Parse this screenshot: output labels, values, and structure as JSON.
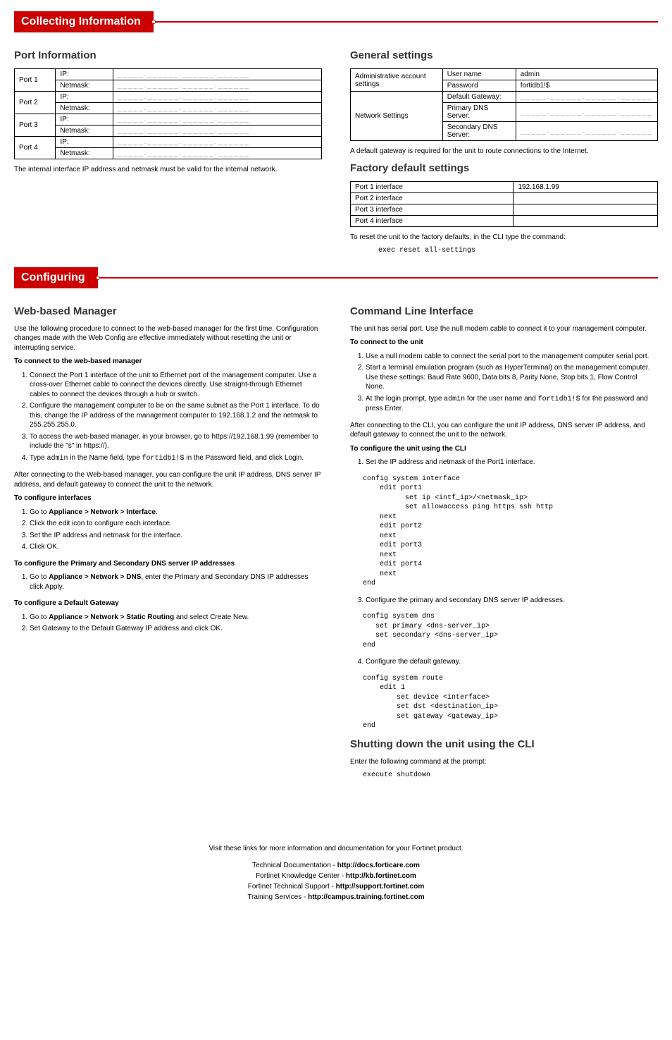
{
  "sections": {
    "collecting": "Collecting Information",
    "configuring": "Configuring"
  },
  "port_info": {
    "title": "Port Information",
    "rows": [
      {
        "label": "Port 1",
        "ip_label": "IP:",
        "mask_label": "Netmask:",
        "blank": "_____.______.______.______"
      },
      {
        "label": "Port 2",
        "ip_label": "IP:",
        "mask_label": "Netmask:",
        "blank": "_____.______.______.______"
      },
      {
        "label": "Port 3",
        "ip_label": "IP:",
        "mask_label": "Netmask:",
        "blank": "_____.______.______.______"
      },
      {
        "label": "Port 4",
        "ip_label": "IP:",
        "mask_label": "Netmask:",
        "blank": "_____.______.______.______"
      }
    ],
    "note": "The internal interface IP address and netmask must be valid for the internal network."
  },
  "general": {
    "title": "General settings",
    "admin_label": "Administrative account settings",
    "user_label": "User name",
    "user_val": "admin",
    "pass_label": "Password",
    "pass_val": "fortidb1!$",
    "net_label": "Network Settings",
    "gw_label": "Default Gateway:",
    "pdns_label": "Primary DNS Server:",
    "sdns_label": "Secondary DNS Server:",
    "blank": "_____.______.______.______",
    "note": "A default gateway is required for the unit to route connections to the Internet."
  },
  "factory": {
    "title": "Factory default settings",
    "rows": [
      {
        "label": "Port 1 interface",
        "val": "192.168.1.99"
      },
      {
        "label": "Port 2 interface",
        "val": ""
      },
      {
        "label": "Port 3 interface",
        "val": ""
      },
      {
        "label": "Port 4 interface",
        "val": ""
      }
    ],
    "note": "To reset the unit to the factory defaults, in the CLI type the command:",
    "cmd": "exec reset all-settings"
  },
  "web": {
    "title": "Web-based Manager",
    "intro": "Use the following procedure to connect to the web-based manager for the first time. Configuration changes made with the Web Config are effective immediately without resetting the unit or interrupting service.",
    "h1": "To connect to the web-based manager",
    "steps1": [
      "Connect the Port 1 interface of the unit to Ethernet port of the management computer. Use a cross-over Ethernet cable to connect the devices directly. Use straight-through Ethernet cables to connect the devices through a hub or switch.",
      "Configure the management computer to be on the same subnet as the Port 1 interface. To do this, change the IP address of the management computer to 192.168.1.2 and the netmask to 255.255.255.0.",
      "To access the web-based manager, in your browser, go to https://192.168.1.99 (remember to include the \"s\" in https://).",
      "Type admin in the Name field, type fortidb1!$ in the Password field, and click Login."
    ],
    "post1": "After connecting to the Web-based manager, you can configure the unit IP address, DNS server IP address, and default gateway to connect the unit to the network.",
    "h2": "To configure interfaces",
    "steps2_pre": "Go to ",
    "steps2_bold": "Appliance > Network > Interface",
    "steps2": [
      "Click the edit icon to configure each interface.",
      "Set the IP address and netmask for the interface.",
      "Click OK."
    ],
    "h3": "To configure the Primary and Secondary DNS server IP addresses",
    "steps3_pre": "Go to ",
    "steps3_bold": "Appliance > Network > DNS",
    "steps3_post": ", enter the Primary and Secondary DNS IP addresses click Apply.",
    "h4": "To configure a Default Gateway",
    "steps4a_pre": "Go to ",
    "steps4a_bold": "Appliance > Network > Static Routing",
    "steps4a_post": " and select Create New.",
    "steps4b": "Set Gateway to the Default Gateway IP address and click OK."
  },
  "cli": {
    "title": "Command Line Interface",
    "intro": "The unit has serial port. Use the null modem cable to connect it to your management computer.",
    "h1": "To connect to the unit",
    "steps1": [
      "Use a null modem cable to connect the serial port to the management computer serial port.",
      "Start a terminal emulation program (such as HyperTerminal) on the management computer. Use these settings: Baud Rate 9600, Data bits 8, Parity None, Stop bits 1, Flow Control None.",
      "At the login prompt, type admin for the user name and fortidb1!$ for the password and press Enter."
    ],
    "post1": "After connecting to the CLI, you can configure the unit IP address, DNS server IP address, and default gateway to connect the unit to the network.",
    "h2": "To configure the unit using the CLI",
    "step_a": "Set the IP address and netmask of the Port1 interface.",
    "code_a": "config system interface\n    edit port1\n          set ip <intf_ip>/<netmask_ip>\n          set allowaccess ping https ssh http\n    next\n    edit port2\n    next\n    edit port3\n    next\n    edit port4\n    next\nend",
    "step_b": "Configure the primary and secondary DNS server IP addresses.",
    "code_b": "config system dns\n   set primary <dns-server_ip>\n   set secondary <dns-server_ip>\nend",
    "step_c": "Configure the default gateway.",
    "code_c": "config system route\n    edit 1\n        set device <interface>\n        set dst <destination_ip>\n        set gateway <gateway_ip>\nend"
  },
  "shutdown": {
    "title": "Shutting down the unit using the CLI",
    "intro": "Enter the following command at the prompt:",
    "cmd": "execute shutdown"
  },
  "footer": {
    "line1": "Visit these links for more information and documentation for your Fortinet product.",
    "l1a": "Technical Documentation - ",
    "l1b": "http://docs.forticare.com",
    "l2a": "Fortinet Knowledge Center - ",
    "l2b": "http://kb.fortinet.com",
    "l3a": "Fortinet Technical Support - ",
    "l3b": "http://support.fortinet.com",
    "l4a": "Training Services - ",
    "l4b": "http://campus.training.fortinet.com"
  }
}
